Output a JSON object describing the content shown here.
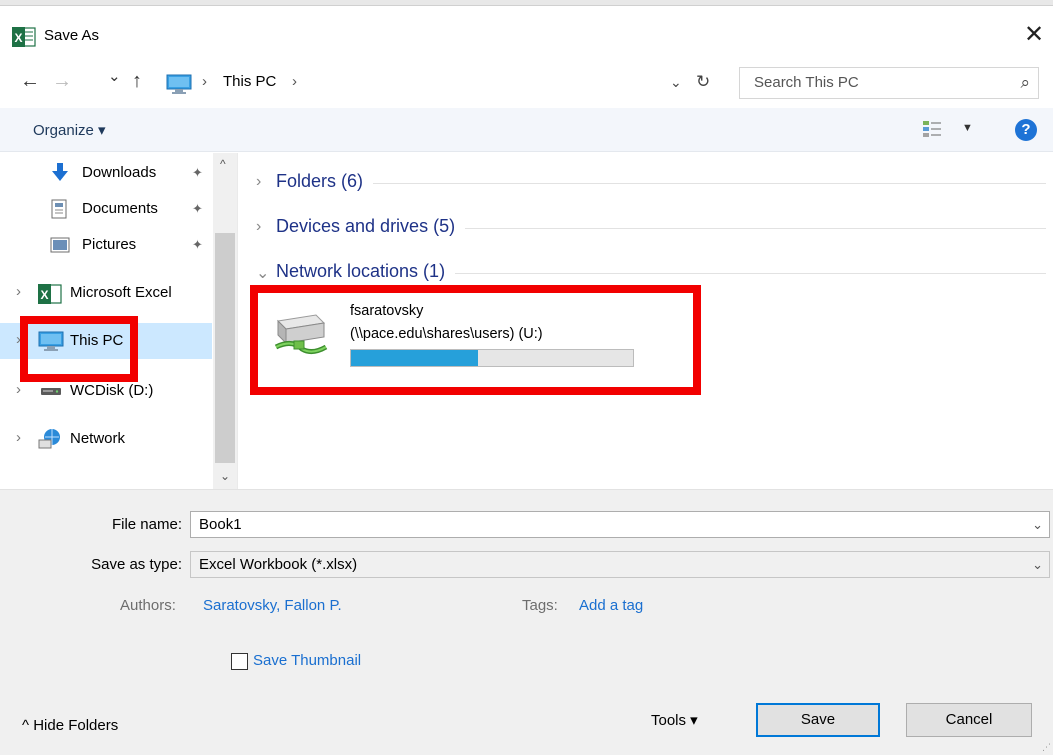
{
  "window": {
    "title": "Save As",
    "close_label": "✕"
  },
  "nav": {
    "back": "←",
    "forward": "→",
    "recent": "⌄",
    "up": "↑",
    "breadcrumb": [
      "This PC"
    ],
    "crumb_sep": "›",
    "dropdown": "⌄",
    "refresh": "↻",
    "search_placeholder": "Search This PC",
    "search_icon": "⌕"
  },
  "toolbar": {
    "organize_label": "Organize ▾",
    "view_dropdown": "▼",
    "help_label": "?"
  },
  "sidebar": {
    "items": [
      {
        "label": "Downloads",
        "icon": "downloads-icon",
        "pinned": true
      },
      {
        "label": "Documents",
        "icon": "documents-icon",
        "pinned": true
      },
      {
        "label": "Pictures",
        "icon": "pictures-icon",
        "pinned": true
      },
      {
        "label": "Microsoft Excel",
        "icon": "excel-icon",
        "expandable": true
      },
      {
        "label": "This PC",
        "icon": "computer-icon",
        "expandable": true,
        "selected": true
      },
      {
        "label": "WCDisk (D:)",
        "icon": "drive-icon",
        "expandable": true
      },
      {
        "label": "Network",
        "icon": "network-icon",
        "expandable": true
      }
    ],
    "pin_glyph": "📌",
    "expand_glyph": "›",
    "scroll_up": "^",
    "scroll_down": "⌄"
  },
  "main": {
    "groups": [
      {
        "label": "Folders (6)",
        "expanded": false,
        "chevron": "›"
      },
      {
        "label": "Devices and drives (5)",
        "expanded": false,
        "chevron": "›"
      },
      {
        "label": "Network locations (1)",
        "expanded": true,
        "chevron": "⌄"
      }
    ],
    "network_location": {
      "name": "fsaratovsky",
      "path": "(\\\\pace.edu\\shares\\users) (U:)",
      "usage_fraction": 0.45
    }
  },
  "form": {
    "file_name_label": "File name:",
    "file_name_value": "Book1",
    "save_type_label": "Save as type:",
    "save_type_value": "Excel Workbook (*.xlsx)",
    "dropdown_glyph": "⌄",
    "authors_label": "Authors:",
    "authors_value": "Saratovsky, Fallon P.",
    "tags_label": "Tags:",
    "tags_value": "Add a tag",
    "thumbnail_label": "Save Thumbnail",
    "thumbnail_checked": false
  },
  "footer": {
    "hide_folders_label": "^  Hide Folders",
    "tools_label": "Tools   ▾",
    "save_label": "Save",
    "cancel_label": "Cancel"
  },
  "colors": {
    "highlight": "#f20000",
    "selection": "#cce8ff",
    "link": "#1a6fd0",
    "group_header": "#1e3287",
    "progress": "#26a0da"
  }
}
